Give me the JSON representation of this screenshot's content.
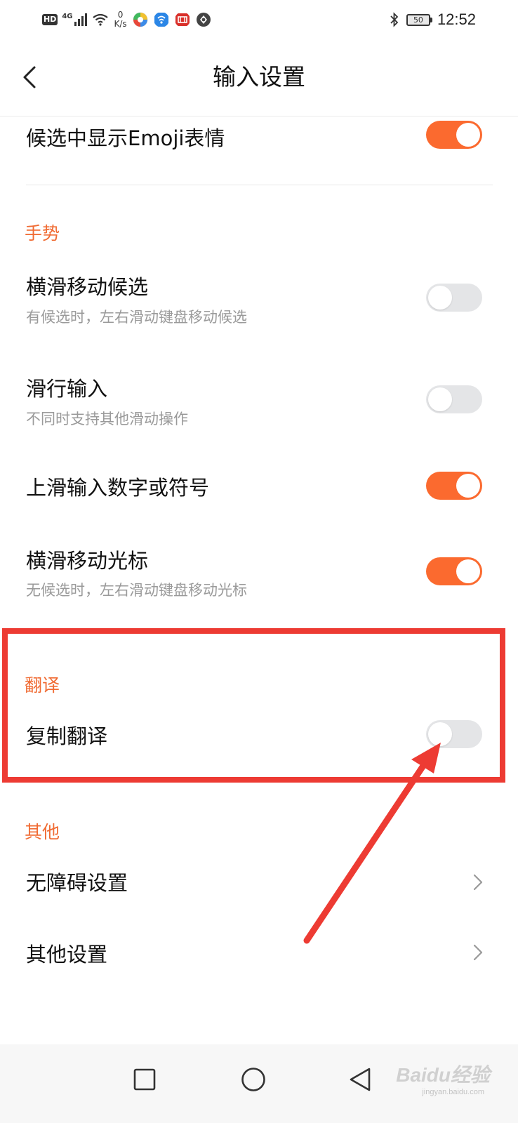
{
  "status_bar": {
    "hd_label": "HD",
    "network_label": "4G",
    "speed_value": "0",
    "speed_unit": "K/s",
    "battery_level": "50",
    "time": "12:52"
  },
  "header": {
    "title": "输入设置"
  },
  "settings": {
    "emoji": {
      "title": "候选中显示Emoji表情",
      "enabled": true
    },
    "gesture_section": "手势",
    "swipe_candidates": {
      "title": "横滑移动候选",
      "subtitle": "有候选时，左右滑动键盘移动候选",
      "enabled": false
    },
    "glide_input": {
      "title": "滑行输入",
      "subtitle": "不同时支持其他滑动操作",
      "enabled": false
    },
    "swipe_up_symbols": {
      "title": "上滑输入数字或符号",
      "enabled": true
    },
    "swipe_cursor": {
      "title": "横滑移动光标",
      "subtitle": "无候选时，左右滑动键盘移动光标",
      "enabled": true
    },
    "translate_section": "翻译",
    "copy_translate": {
      "title": "复制翻译",
      "enabled": false
    },
    "other_section": "其他",
    "accessibility": {
      "title": "无障碍设置"
    },
    "other_settings": {
      "title": "其他设置"
    }
  },
  "watermark": {
    "brand": "Baidu经验",
    "url": "jingyan.baidu.com"
  },
  "colors": {
    "accent": "#fb6a2f",
    "section_title": "#f06b33",
    "annotation": "#ed3b33",
    "toggle_off": "#e4e5e7"
  },
  "icons": [
    "back-arrow-icon",
    "chevron-right-icon",
    "nav-recents-icon",
    "nav-home-icon",
    "nav-back-icon",
    "bluetooth-icon",
    "wifi-icon",
    "signal-icon",
    "battery-icon"
  ]
}
